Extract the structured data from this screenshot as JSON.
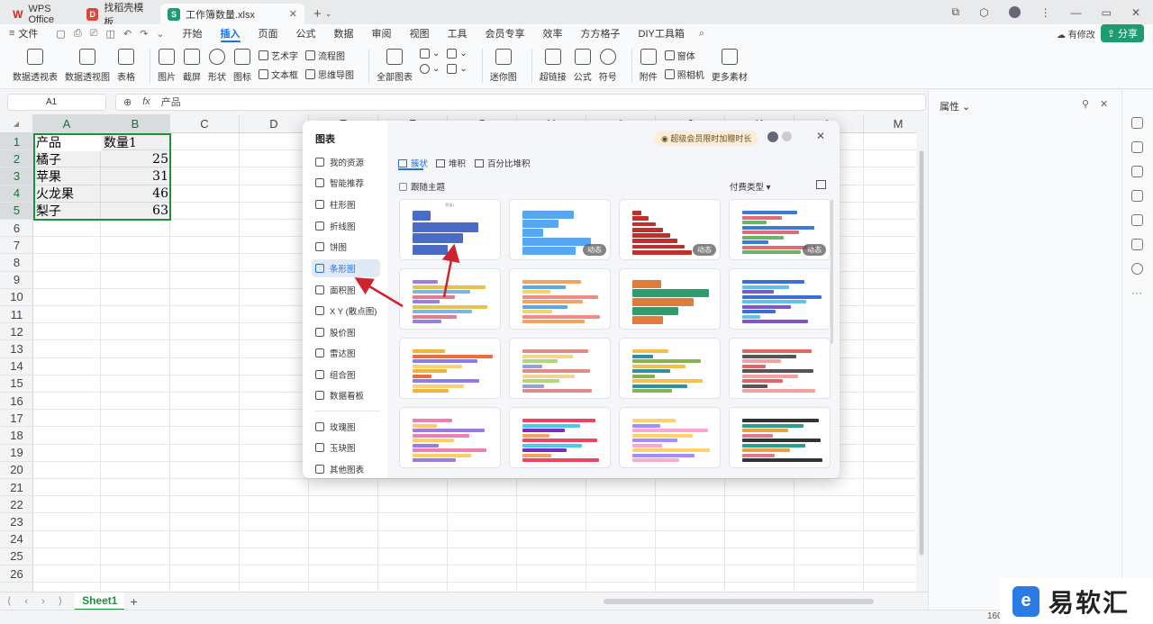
{
  "tabs": [
    {
      "label": "WPS Office"
    },
    {
      "label": "找稻壳模板"
    },
    {
      "label": "工作簿数量.xlsx"
    }
  ],
  "menu": {
    "file": "文件",
    "items": [
      "开始",
      "插入",
      "页面",
      "公式",
      "数据",
      "审阅",
      "视图",
      "工具",
      "会员专享",
      "效率",
      "方方格子",
      "DIY工具箱"
    ],
    "active": "插入",
    "modified": "有修改",
    "share": "分享"
  },
  "ribbon": {
    "pivot_table": "数据透视表",
    "pivot_chart": "数据透视图",
    "table": "表格",
    "picture": "图片",
    "screenshot": "截屏",
    "shape": "形状",
    "icon": "图标",
    "art_text": "艺术字",
    "text_box": "文本框",
    "flowchart": "流程图",
    "mindmap": "思维导图",
    "all_charts": "全部图表",
    "sparkline": "迷你图",
    "hyperlink": "超链接",
    "formula": "公式",
    "symbol": "符号",
    "attachment": "附件",
    "window": "窗体",
    "camera": "照相机",
    "more": "更多素材"
  },
  "formula_bar": {
    "name_box": "A1",
    "fx": "fx",
    "content": "产品"
  },
  "sheet": {
    "columns": [
      "A",
      "B",
      "C",
      "D",
      "E",
      "F",
      "G",
      "H",
      "I",
      "J",
      "K",
      "L",
      "M"
    ],
    "rows": [
      "1",
      "2",
      "3",
      "4",
      "5",
      "6",
      "7",
      "8",
      "9",
      "10",
      "11",
      "12",
      "13",
      "14",
      "15",
      "16",
      "17",
      "18",
      "19",
      "20",
      "21",
      "22",
      "23",
      "24",
      "25",
      "26"
    ],
    "cells": [
      {
        "a": "产品",
        "b": "数量1"
      },
      {
        "a": "橘子",
        "b": "25"
      },
      {
        "a": "苹果",
        "b": "31"
      },
      {
        "a": "火龙果",
        "b": "46"
      },
      {
        "a": "梨子",
        "b": "63"
      }
    ],
    "tab": "Sheet1",
    "add": "+"
  },
  "panel": {
    "title": "属性"
  },
  "dialog": {
    "title": "图表",
    "nav": [
      "我的资源",
      "智能推荐",
      "柱形图",
      "折线图",
      "饼图",
      "条形图",
      "面积图",
      "X Y (散点图)",
      "股价图",
      "雷达图",
      "组合图",
      "数据看板",
      "玫瑰图",
      "玉玦图",
      "其他图表"
    ],
    "active_nav": "条形图",
    "promo": "超级会员限时加赠时长",
    "subtabs": [
      "簇状",
      "堆积",
      "百分比堆积"
    ],
    "active_subtab": "簇状",
    "follow_theme": "跟随主题",
    "paid_type": "付费类型",
    "dynamic_badge": "动态",
    "thumb_title": "数量1"
  },
  "zoom": "160",
  "logo": {
    "text": "易软汇"
  }
}
